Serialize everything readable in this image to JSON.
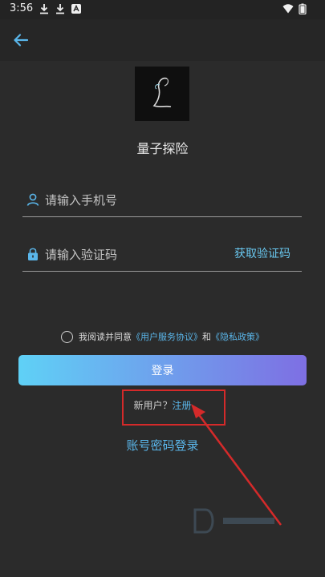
{
  "status_bar": {
    "time": "3:56",
    "icons": [
      "download-icon",
      "download-icon",
      "app-notification-icon",
      "wifi-icon",
      "battery-icon"
    ]
  },
  "app": {
    "name": "量子探险"
  },
  "form": {
    "phone_placeholder": "请输入手机号",
    "phone_value": "",
    "code_placeholder": "请输入验证码",
    "code_value": "",
    "get_code_label": "获取验证码"
  },
  "agreement": {
    "prefix": "我阅读并同意",
    "terms_link": "《用户服务协议》",
    "and": "和",
    "privacy_link": "《隐私政策》"
  },
  "login_button_label": "登录",
  "register": {
    "prompt": "新用户？",
    "link": "注册"
  },
  "password_login_label": "账号密码登录",
  "colors": {
    "background": "#2b2b2b",
    "accent": "#5ab6ea",
    "gradient_start": "#5fd1f6",
    "gradient_end": "#7e6fe3",
    "annotation": "#d42a2a"
  }
}
